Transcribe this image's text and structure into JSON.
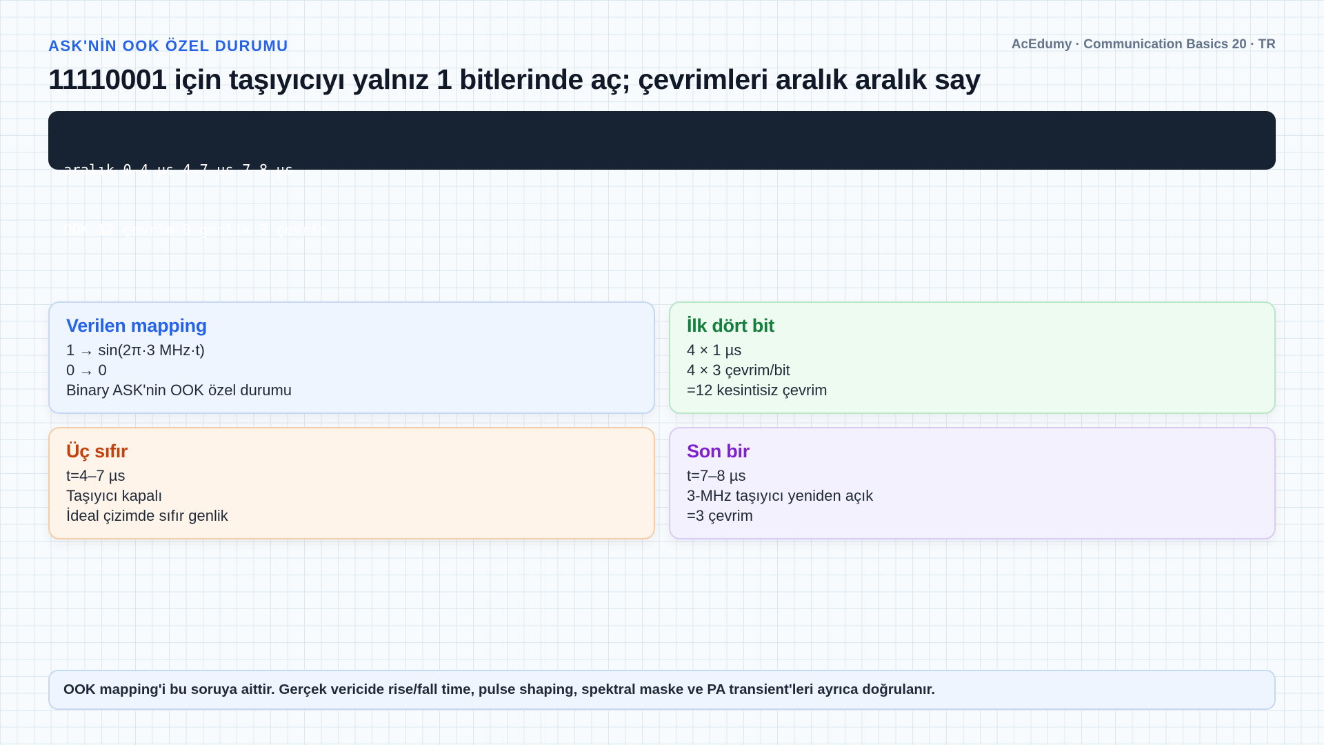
{
  "header": {
    "eyebrow": "ASK'NİN OOK ÖZEL DURUMU",
    "brand": "AcEdumy · Communication Basics 20 · TR",
    "title": "11110001 için taşıyıcıyı yalnız 1 bitlerinde aç; çevrimleri aralık aralık say"
  },
  "code": {
    "lines": [
      "aralık 0–4 µs 4–7 µs 7–8 µs",
      "OOK 12 çevrim 0 genlik 3 çevrim"
    ]
  },
  "cards": [
    {
      "title": "Verilen mapping",
      "lines": [
        "1 → sin(2π·3 MHz·t)",
        "0 → 0",
        "Binary ASK'nin OOK özel durumu"
      ],
      "accent": "#2563eb"
    },
    {
      "title": "İlk dört bit",
      "lines": [
        "4 × 1 µs",
        "4 × 3 çevrim/bit",
        "=12 kesintisiz çevrim"
      ],
      "accent": "#15803d"
    },
    {
      "title": "Üç sıfır",
      "lines": [
        "t=4–7 µs",
        "Taşıyıcı kapalı",
        "İdeal çizimde sıfır genlik"
      ],
      "accent": "#c2410c"
    },
    {
      "title": "Son bir",
      "lines": [
        "t=7–8 µs",
        "3-MHz taşıyıcı yeniden açık",
        "=3 çevrim"
      ],
      "accent": "#7e22ce"
    }
  ],
  "footer": {
    "note": "OOK mapping'i bu soruya aittir. Gerçek vericide rise/fall time, pulse shaping, spektral maske ve PA transient'leri ayrıca doğrulanır."
  }
}
